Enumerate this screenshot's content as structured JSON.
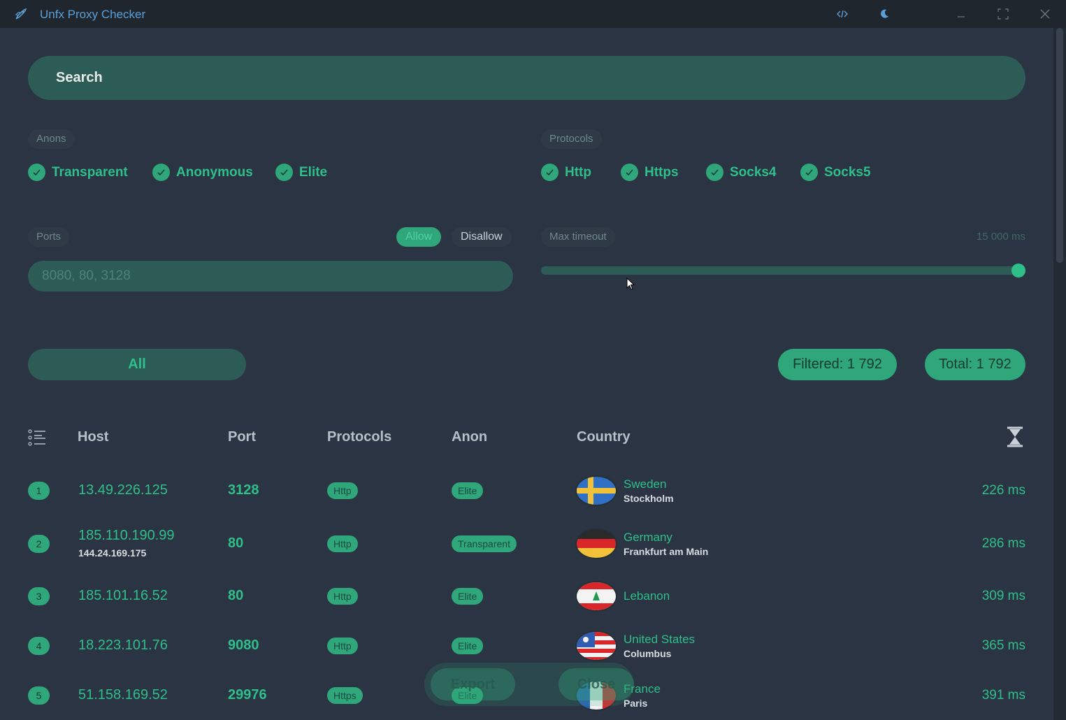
{
  "window": {
    "title": "Unfx Proxy Checker",
    "buttons": [
      "code-icon",
      "moon-icon",
      "minimize-icon",
      "maximize-icon",
      "close-icon"
    ]
  },
  "search": {
    "placeholder": "Search"
  },
  "anons": {
    "label": "Anons",
    "items": [
      "Transparent",
      "Anonymous",
      "Elite"
    ]
  },
  "protocols": {
    "label": "Protocols",
    "items": [
      "Http",
      "Https",
      "Socks4",
      "Socks5"
    ]
  },
  "ports": {
    "label": "Ports",
    "allow": "Allow",
    "disallow": "Disallow",
    "value": "8080, 80, 3128"
  },
  "timeout": {
    "label": "Max timeout",
    "value": "15 000 ms",
    "level": 1.0
  },
  "filter": {
    "all": "All",
    "filtered": "Filtered: 1 792",
    "total": "Total: 1 792"
  },
  "table": {
    "headers": {
      "host": "Host",
      "port": "Port",
      "protocols": "Protocols",
      "anon": "Anon",
      "country": "Country"
    },
    "rows": [
      {
        "num": "1",
        "host": "13.49.226.125",
        "host_sub": "",
        "port": "3128",
        "protocol": "Http",
        "anon": "Elite",
        "country": "Sweden",
        "city": "Stockholm",
        "ms": "226 ms"
      },
      {
        "num": "2",
        "host": "185.110.190.99",
        "host_sub": "144.24.169.175",
        "port": "80",
        "protocol": "Http",
        "anon": "Transparent",
        "country": "Germany",
        "city": "Frankfurt am Main",
        "ms": "286 ms"
      },
      {
        "num": "3",
        "host": "185.101.16.52",
        "host_sub": "",
        "port": "80",
        "protocol": "Http",
        "anon": "Elite",
        "country": "Lebanon",
        "city": "",
        "ms": "309 ms"
      },
      {
        "num": "4",
        "host": "18.223.101.76",
        "host_sub": "",
        "port": "9080",
        "protocol": "Http",
        "anon": "Elite",
        "country": "United States",
        "city": "Columbus",
        "ms": "365 ms"
      },
      {
        "num": "5",
        "host": "51.158.169.52",
        "host_sub": "",
        "port": "29976",
        "protocol": "Https",
        "anon": "Elite",
        "country": "France",
        "city": "Paris",
        "ms": "391 ms"
      }
    ]
  },
  "footer": {
    "export": "Export",
    "close": "Close"
  },
  "colors": {
    "accent": "#2fa77b",
    "accent_text": "#2fbf8a",
    "background": "#2b3442",
    "field": "#2d5c57"
  }
}
